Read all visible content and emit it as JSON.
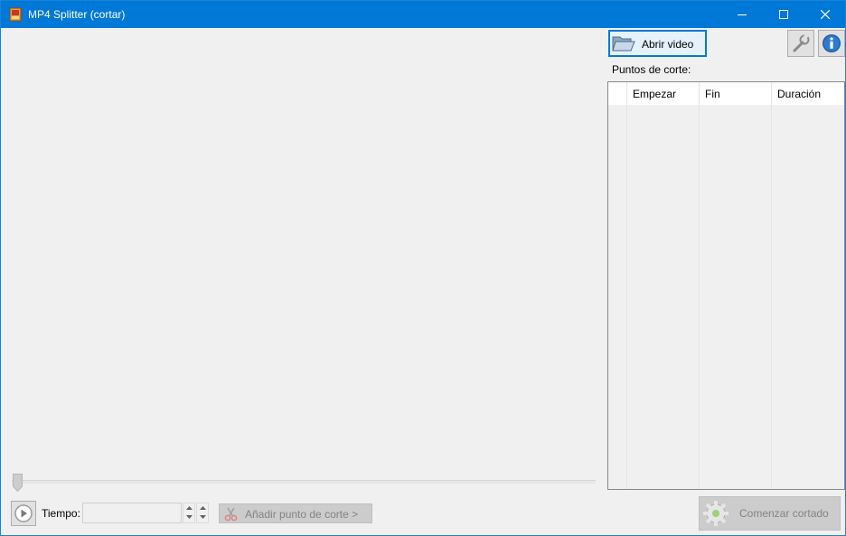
{
  "window": {
    "title": "MP4 Splitter (cortar)",
    "accent_color": "#0078d7",
    "controls": [
      "minimize-icon",
      "maximize-icon",
      "close-icon"
    ]
  },
  "toolbar": {
    "open_video_label": "Abrir video",
    "settings_icon": "wrench-icon",
    "info_icon": "info-icon"
  },
  "cut_points": {
    "label": "Puntos de corte:",
    "columns": [
      "",
      "Empezar",
      "Fin",
      "Duración"
    ],
    "rows": []
  },
  "player": {
    "play_icon": "play-icon",
    "time_label": "Tiempo:",
    "time_value": "",
    "seek_position": 0
  },
  "actions": {
    "add_cut_label": "Añadir punto de corte >",
    "add_cut_icon": "scissors-icon",
    "start_cut_label": "Comenzar cortado",
    "start_cut_icon": "gear-icon"
  }
}
